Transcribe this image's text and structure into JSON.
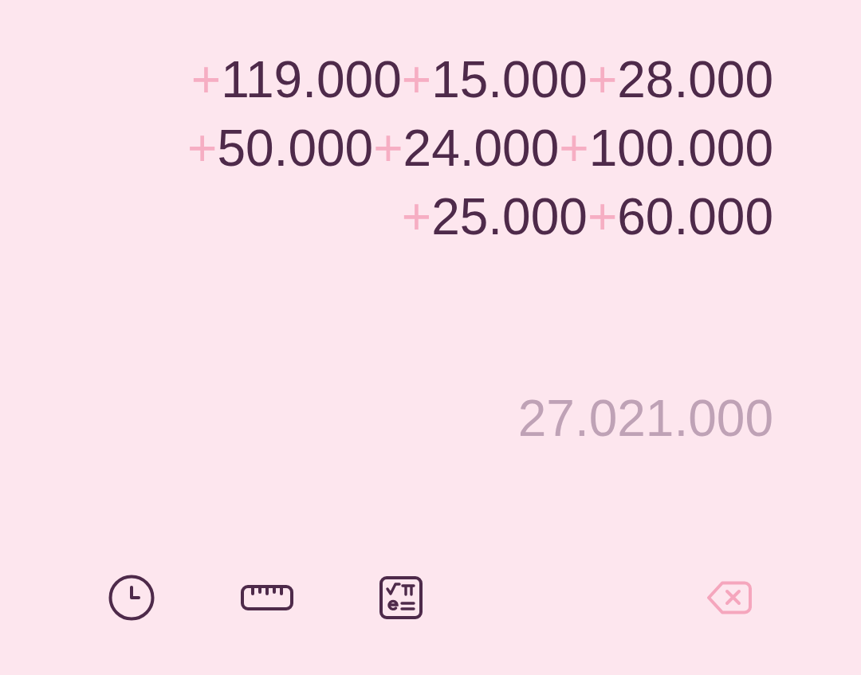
{
  "expression": {
    "lines": [
      [
        {
          "operator": "+",
          "number": "119.000"
        },
        {
          "operator": "+",
          "number": "15.000"
        },
        {
          "operator": "+",
          "number": "28.000"
        }
      ],
      [
        {
          "operator": "+",
          "number": "50.000"
        },
        {
          "operator": "+",
          "number": "24.000"
        },
        {
          "operator": "+",
          "number": "100.000"
        }
      ],
      [
        {
          "operator": "+",
          "number": "25.000"
        },
        {
          "operator": "+",
          "number": "60.000"
        }
      ]
    ]
  },
  "result": {
    "preview": "27.021.000"
  },
  "toolbar": {
    "buttons": [
      {
        "kind": "history"
      },
      {
        "kind": "converter"
      },
      {
        "kind": "scientific"
      },
      {
        "kind": "backspace"
      }
    ]
  }
}
